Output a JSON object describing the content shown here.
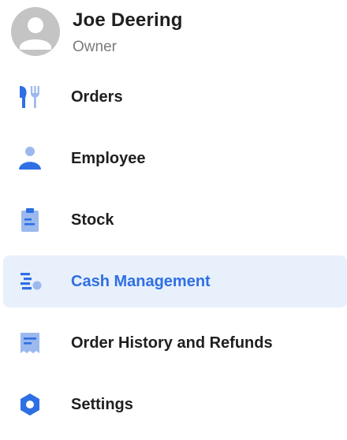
{
  "user": {
    "name": "Joe  Deering",
    "role": "Owner"
  },
  "nav": {
    "items": [
      {
        "label": "Orders",
        "icon": "cutlery-icon"
      },
      {
        "label": "Employee",
        "icon": "person-icon"
      },
      {
        "label": "Stock",
        "icon": "clipboard-icon"
      },
      {
        "label": "Cash Management",
        "icon": "cash-management-icon",
        "active": true
      },
      {
        "label": "Order History and Refunds",
        "icon": "receipt-icon"
      },
      {
        "label": "Settings",
        "icon": "gear-icon"
      }
    ]
  },
  "colors": {
    "accent": "#2f6fe4",
    "icon_dark": "#2f6fe4",
    "icon_light": "#9bb9ee",
    "active_background": "#e8f0fb",
    "avatar_background": "#c4c4c4",
    "text_primary": "#1f1f1f",
    "text_secondary": "#7a7a7a"
  }
}
